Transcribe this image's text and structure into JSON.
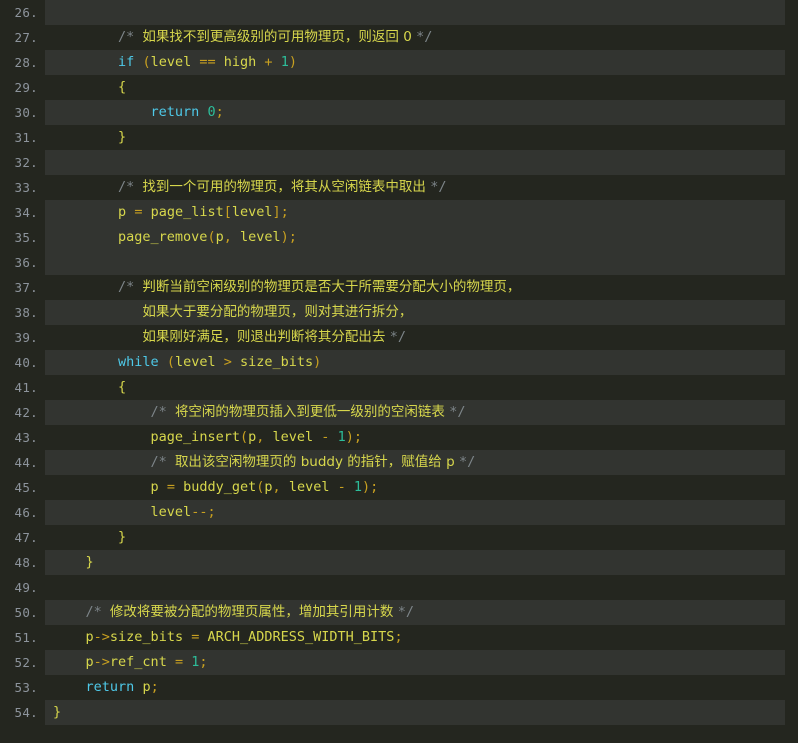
{
  "editor": {
    "title": "source-code-listing",
    "language": "c",
    "first_line_number": 26,
    "last_line_number": 54,
    "theme": {
      "background": "#24261f",
      "stripe_background": "#323430",
      "line_number_color": "#8d949c",
      "keyword_color": "#4ec9e8",
      "identifier_color": "#d7d74c",
      "operator_color": "#c8a020",
      "number_color": "#2dbd9a",
      "comment_color": "#7d8589"
    }
  },
  "lines": [
    {
      "n": "26.",
      "stripe": true,
      "tokens": []
    },
    {
      "n": "27.",
      "stripe": false,
      "tokens": [
        {
          "c": "pl",
          "t": "        "
        },
        {
          "c": "cmt",
          "t": "/* "
        },
        {
          "c": "cmt-cjk",
          "t": "如果找不到更高级别的可用物理页，则返回 0 "
        },
        {
          "c": "cmt",
          "t": "*/"
        }
      ]
    },
    {
      "n": "28.",
      "stripe": true,
      "tokens": [
        {
          "c": "pl",
          "t": "        "
        },
        {
          "c": "kw",
          "t": "if"
        },
        {
          "c": "pl",
          "t": " "
        },
        {
          "c": "op",
          "t": "("
        },
        {
          "c": "id",
          "t": "level"
        },
        {
          "c": "pl",
          "t": " "
        },
        {
          "c": "op",
          "t": "=="
        },
        {
          "c": "pl",
          "t": " "
        },
        {
          "c": "id",
          "t": "high"
        },
        {
          "c": "pl",
          "t": " "
        },
        {
          "c": "op",
          "t": "+"
        },
        {
          "c": "pl",
          "t": " "
        },
        {
          "c": "num",
          "t": "1"
        },
        {
          "c": "op",
          "t": ")"
        }
      ]
    },
    {
      "n": "29.",
      "stripe": false,
      "tokens": [
        {
          "c": "pl",
          "t": "        "
        },
        {
          "c": "id",
          "t": "{"
        }
      ]
    },
    {
      "n": "30.",
      "stripe": true,
      "tokens": [
        {
          "c": "pl",
          "t": "            "
        },
        {
          "c": "kw",
          "t": "return"
        },
        {
          "c": "pl",
          "t": " "
        },
        {
          "c": "num",
          "t": "0"
        },
        {
          "c": "op",
          "t": ";"
        }
      ]
    },
    {
      "n": "31.",
      "stripe": false,
      "tokens": [
        {
          "c": "pl",
          "t": "        "
        },
        {
          "c": "id",
          "t": "}"
        }
      ]
    },
    {
      "n": "32.",
      "stripe": true,
      "tokens": []
    },
    {
      "n": "33.",
      "stripe": false,
      "tokens": [
        {
          "c": "pl",
          "t": "        "
        },
        {
          "c": "cmt",
          "t": "/* "
        },
        {
          "c": "cmt-cjk",
          "t": "找到一个可用的物理页，将其从空闲链表中取出 "
        },
        {
          "c": "cmt",
          "t": "*/"
        }
      ]
    },
    {
      "n": "34.",
      "stripe": true,
      "tokens": [
        {
          "c": "pl",
          "t": "        "
        },
        {
          "c": "id",
          "t": "p"
        },
        {
          "c": "pl",
          "t": " "
        },
        {
          "c": "op",
          "t": "="
        },
        {
          "c": "pl",
          "t": " "
        },
        {
          "c": "id",
          "t": "page_list"
        },
        {
          "c": "op",
          "t": "["
        },
        {
          "c": "id",
          "t": "level"
        },
        {
          "c": "op",
          "t": "];"
        }
      ]
    },
    {
      "n": "35.",
      "stripe": true,
      "tokens": [
        {
          "c": "pl",
          "t": "        "
        },
        {
          "c": "id",
          "t": "page_remove"
        },
        {
          "c": "op",
          "t": "("
        },
        {
          "c": "id",
          "t": "p"
        },
        {
          "c": "op",
          "t": ","
        },
        {
          "c": "pl",
          "t": " "
        },
        {
          "c": "id",
          "t": "level"
        },
        {
          "c": "op",
          "t": ");"
        }
      ]
    },
    {
      "n": "36.",
      "stripe": true,
      "tokens": []
    },
    {
      "n": "37.",
      "stripe": false,
      "tokens": [
        {
          "c": "pl",
          "t": "        "
        },
        {
          "c": "cmt",
          "t": "/* "
        },
        {
          "c": "cmt-cjk",
          "t": "判断当前空闲级别的物理页是否大于所需要分配大小的物理页，"
        }
      ]
    },
    {
      "n": "38.",
      "stripe": true,
      "tokens": [
        {
          "c": "pl",
          "t": "           "
        },
        {
          "c": "cmt-cjk",
          "t": "如果大于要分配的物理页，则对其进行拆分，"
        }
      ]
    },
    {
      "n": "39.",
      "stripe": false,
      "tokens": [
        {
          "c": "pl",
          "t": "           "
        },
        {
          "c": "cmt-cjk",
          "t": "如果刚好满足，则退出判断将其分配出去 "
        },
        {
          "c": "cmt",
          "t": "*/"
        }
      ]
    },
    {
      "n": "40.",
      "stripe": true,
      "tokens": [
        {
          "c": "pl",
          "t": "        "
        },
        {
          "c": "kw",
          "t": "while"
        },
        {
          "c": "pl",
          "t": " "
        },
        {
          "c": "op",
          "t": "("
        },
        {
          "c": "id",
          "t": "level"
        },
        {
          "c": "pl",
          "t": " "
        },
        {
          "c": "op",
          "t": ">"
        },
        {
          "c": "pl",
          "t": " "
        },
        {
          "c": "id",
          "t": "size_bits"
        },
        {
          "c": "op",
          "t": ")"
        }
      ]
    },
    {
      "n": "41.",
      "stripe": false,
      "tokens": [
        {
          "c": "pl",
          "t": "        "
        },
        {
          "c": "id",
          "t": "{"
        }
      ]
    },
    {
      "n": "42.",
      "stripe": true,
      "tokens": [
        {
          "c": "pl",
          "t": "            "
        },
        {
          "c": "cmt",
          "t": "/* "
        },
        {
          "c": "cmt-cjk",
          "t": "将空闲的物理页插入到更低一级别的空闲链表 "
        },
        {
          "c": "cmt",
          "t": "*/"
        }
      ]
    },
    {
      "n": "43.",
      "stripe": false,
      "tokens": [
        {
          "c": "pl",
          "t": "            "
        },
        {
          "c": "id",
          "t": "page_insert"
        },
        {
          "c": "op",
          "t": "("
        },
        {
          "c": "id",
          "t": "p"
        },
        {
          "c": "op",
          "t": ","
        },
        {
          "c": "pl",
          "t": " "
        },
        {
          "c": "id",
          "t": "level"
        },
        {
          "c": "pl",
          "t": " "
        },
        {
          "c": "op",
          "t": "-"
        },
        {
          "c": "pl",
          "t": " "
        },
        {
          "c": "num",
          "t": "1"
        },
        {
          "c": "op",
          "t": ");"
        }
      ]
    },
    {
      "n": "44.",
      "stripe": true,
      "tokens": [
        {
          "c": "pl",
          "t": "            "
        },
        {
          "c": "cmt",
          "t": "/* "
        },
        {
          "c": "cmt-cjk",
          "t": "取出该空闲物理页的 buddy 的指针，赋值给 p "
        },
        {
          "c": "cmt",
          "t": "*/"
        }
      ]
    },
    {
      "n": "45.",
      "stripe": false,
      "tokens": [
        {
          "c": "pl",
          "t": "            "
        },
        {
          "c": "id",
          "t": "p"
        },
        {
          "c": "pl",
          "t": " "
        },
        {
          "c": "op",
          "t": "="
        },
        {
          "c": "pl",
          "t": " "
        },
        {
          "c": "id",
          "t": "buddy_get"
        },
        {
          "c": "op",
          "t": "("
        },
        {
          "c": "id",
          "t": "p"
        },
        {
          "c": "op",
          "t": ","
        },
        {
          "c": "pl",
          "t": " "
        },
        {
          "c": "id",
          "t": "level"
        },
        {
          "c": "pl",
          "t": " "
        },
        {
          "c": "op",
          "t": "-"
        },
        {
          "c": "pl",
          "t": " "
        },
        {
          "c": "num",
          "t": "1"
        },
        {
          "c": "op",
          "t": ");"
        }
      ]
    },
    {
      "n": "46.",
      "stripe": true,
      "tokens": [
        {
          "c": "pl",
          "t": "            "
        },
        {
          "c": "id",
          "t": "level"
        },
        {
          "c": "op",
          "t": "--;"
        }
      ]
    },
    {
      "n": "47.",
      "stripe": false,
      "tokens": [
        {
          "c": "pl",
          "t": "        "
        },
        {
          "c": "id",
          "t": "}"
        }
      ]
    },
    {
      "n": "48.",
      "stripe": true,
      "tokens": [
        {
          "c": "pl",
          "t": "    "
        },
        {
          "c": "id",
          "t": "}"
        }
      ]
    },
    {
      "n": "49.",
      "stripe": false,
      "tokens": []
    },
    {
      "n": "50.",
      "stripe": true,
      "tokens": [
        {
          "c": "pl",
          "t": "    "
        },
        {
          "c": "cmt",
          "t": "/* "
        },
        {
          "c": "cmt-cjk",
          "t": "修改将要被分配的物理页属性，增加其引用计数 "
        },
        {
          "c": "cmt",
          "t": "*/"
        }
      ]
    },
    {
      "n": "51.",
      "stripe": false,
      "tokens": [
        {
          "c": "pl",
          "t": "    "
        },
        {
          "c": "id",
          "t": "p"
        },
        {
          "c": "op",
          "t": "->"
        },
        {
          "c": "id",
          "t": "size_bits"
        },
        {
          "c": "pl",
          "t": " "
        },
        {
          "c": "op",
          "t": "="
        },
        {
          "c": "pl",
          "t": " "
        },
        {
          "c": "id",
          "t": "ARCH_ADDRESS_WIDTH_BITS"
        },
        {
          "c": "op",
          "t": ";"
        }
      ]
    },
    {
      "n": "52.",
      "stripe": true,
      "tokens": [
        {
          "c": "pl",
          "t": "    "
        },
        {
          "c": "id",
          "t": "p"
        },
        {
          "c": "op",
          "t": "->"
        },
        {
          "c": "id",
          "t": "ref_cnt"
        },
        {
          "c": "pl",
          "t": " "
        },
        {
          "c": "op",
          "t": "="
        },
        {
          "c": "pl",
          "t": " "
        },
        {
          "c": "num",
          "t": "1"
        },
        {
          "c": "op",
          "t": ";"
        }
      ]
    },
    {
      "n": "53.",
      "stripe": false,
      "tokens": [
        {
          "c": "pl",
          "t": "    "
        },
        {
          "c": "kw",
          "t": "return"
        },
        {
          "c": "pl",
          "t": " "
        },
        {
          "c": "id",
          "t": "p"
        },
        {
          "c": "op",
          "t": ";"
        }
      ]
    },
    {
      "n": "54.",
      "stripe": true,
      "tokens": [
        {
          "c": "id",
          "t": "}"
        }
      ]
    }
  ],
  "code_text": {
    "26": "",
    "27": "        /* 如果找不到更高级别的可用物理页，则返回 0 */",
    "28": "        if (level == high + 1)",
    "29": "        {",
    "30": "            return 0;",
    "31": "        }",
    "32": "",
    "33": "        /* 找到一个可用的物理页，将其从空闲链表中取出 */",
    "34": "        p = page_list[level];",
    "35": "        page_remove(p, level);",
    "36": "",
    "37": "        /* 判断当前空闲级别的物理页是否大于所需要分配大小的物理页，",
    "38": "           如果大于要分配的物理页，则对其进行拆分，",
    "39": "           如果刚好满足，则退出判断将其分配出去 */",
    "40": "        while (level > size_bits)",
    "41": "        {",
    "42": "            /* 将空闲的物理页插入到更低一级别的空闲链表 */",
    "43": "            page_insert(p, level - 1);",
    "44": "            /* 取出该空闲物理页的 buddy 的指针，赋值给 p */",
    "45": "            p = buddy_get(p, level - 1);",
    "46": "            level--;",
    "47": "        }",
    "48": "    }",
    "49": "",
    "50": "    /* 修改将要被分配的物理页属性，增加其引用计数 */",
    "51": "    p->size_bits = ARCH_ADDRESS_WIDTH_BITS;",
    "52": "    p->ref_cnt = 1;",
    "53": "    return p;",
    "54": "}"
  }
}
